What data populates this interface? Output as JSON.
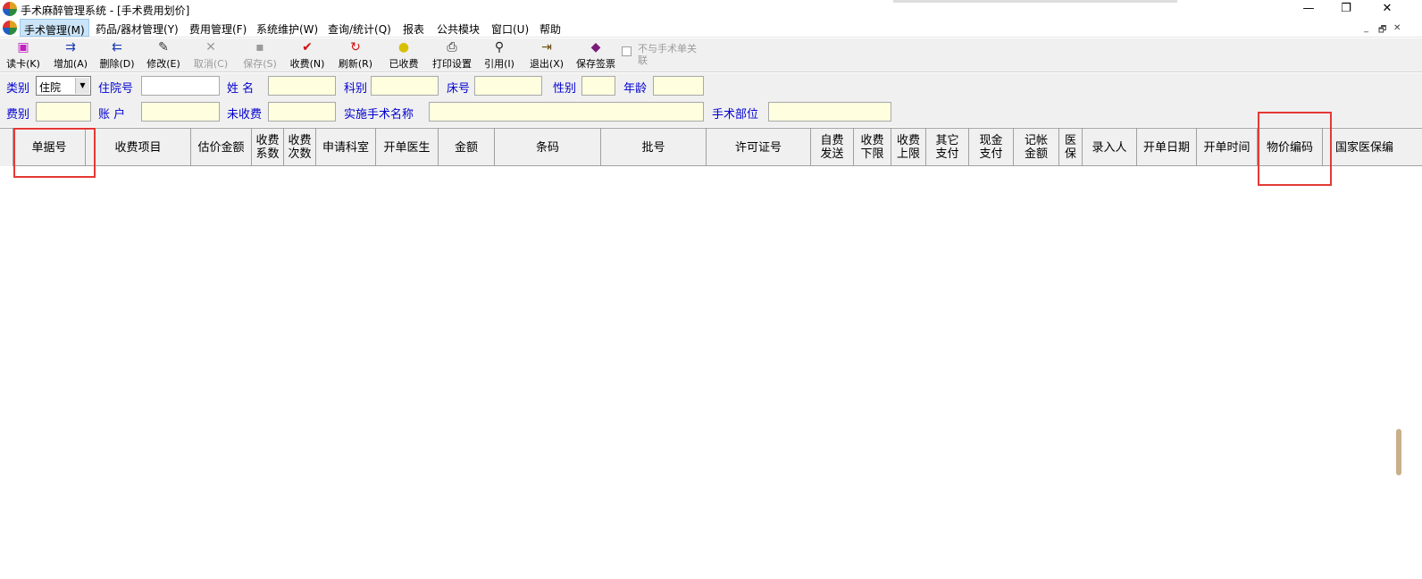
{
  "window": {
    "title": "手术麻醉管理系统 - [手术费用划价]",
    "controls": {
      "minimize": "—",
      "restore": "❐",
      "close": "✕"
    }
  },
  "menu": {
    "items": [
      "手术管理(M)",
      "药品/器材管理(Y)",
      "费用管理(F)",
      "系统维护(W)",
      "查询/统计(Q)",
      "报表",
      "公共模块",
      "窗口(U)",
      "帮助"
    ],
    "mdi_controls": {
      "minimize": "_",
      "restore": "🗗",
      "close": "✕"
    }
  },
  "toolbar": {
    "buttons": [
      {
        "label": "读卡(K)",
        "icon": "card-reader-icon",
        "glyph": "▣",
        "color": "#c020c0",
        "enabled": true
      },
      {
        "label": "增加(A)",
        "icon": "add-icon",
        "glyph": "⇉",
        "color": "#1a3fb0",
        "enabled": true
      },
      {
        "label": "删除(D)",
        "icon": "delete-icon",
        "glyph": "⇇",
        "color": "#1a3fb0",
        "enabled": true
      },
      {
        "label": "修改(E)",
        "icon": "edit-icon",
        "glyph": "✎",
        "color": "#333333",
        "enabled": true
      },
      {
        "label": "取消(C)",
        "icon": "cancel-icon",
        "glyph": "✕",
        "color": "#9a9a9a",
        "enabled": false
      },
      {
        "label": "保存(S)",
        "icon": "save-icon",
        "glyph": "▪",
        "color": "#9a9a9a",
        "enabled": false
      },
      {
        "label": "收费(N)",
        "icon": "charge-checkmark-icon",
        "glyph": "✔",
        "color": "#d01010",
        "enabled": true
      },
      {
        "label": "刷新(R)",
        "icon": "refresh-icon",
        "glyph": "↻",
        "color": "#d01010",
        "enabled": true
      },
      {
        "label": "已收费",
        "icon": "charged-coin-icon",
        "glyph": "●",
        "color": "#d8c000",
        "enabled": true
      },
      {
        "label": "打印设置",
        "icon": "printer-icon",
        "glyph": "⎙",
        "color": "#222222",
        "enabled": true
      },
      {
        "label": "引用(I)",
        "icon": "reference-icon",
        "glyph": "⚲",
        "color": "#222222",
        "enabled": true
      },
      {
        "label": "退出(X)",
        "icon": "exit-door-icon",
        "glyph": "⇥",
        "color": "#6a4a10",
        "enabled": true
      },
      {
        "label": "保存签票",
        "icon": "sign-book-icon",
        "glyph": "◆",
        "color": "#7a1a7a",
        "enabled": true
      }
    ],
    "checkbox": {
      "label": "不与手术单关联",
      "checked": false,
      "enabled": false
    }
  },
  "form": {
    "row1": {
      "category_label": "类别",
      "category_value": "住院",
      "admission_no_label": "住院号",
      "admission_no_value": "",
      "name_label": "姓 名",
      "name_value": "",
      "department_label": "科别",
      "department_value": "",
      "bed_label": "床号",
      "bed_value": "",
      "gender_label": "性别",
      "gender_value": "",
      "age_label": "年龄",
      "age_value": ""
    },
    "row2": {
      "fee_type_label": "费别",
      "fee_type_value": "",
      "account_label": "账 户",
      "account_value": "",
      "unpaid_label": "未收费",
      "unpaid_value": "",
      "surgery_name_label": "实施手术名称",
      "surgery_name_value": "",
      "surgery_site_label": "手术部位",
      "surgery_site_value": ""
    }
  },
  "grid": {
    "columns": [
      "单据号",
      "收费项目",
      "估价金额",
      "收费\n系数",
      "收费\n次数",
      "申请科室",
      "开单医生",
      "金额",
      "条码",
      "批号",
      "许可证号",
      "自费\n发送",
      "收费\n下限",
      "收费\n上限",
      "其它\n支付",
      "现金\n支付",
      "记帐\n金额",
      "医\n保",
      "录入人",
      "开单日期",
      "开单时间",
      "物价编码",
      "国家医保编"
    ],
    "rows": [],
    "highlighted_columns": [
      "单据号",
      "物价编码"
    ],
    "highlight_color": "#e53935"
  }
}
